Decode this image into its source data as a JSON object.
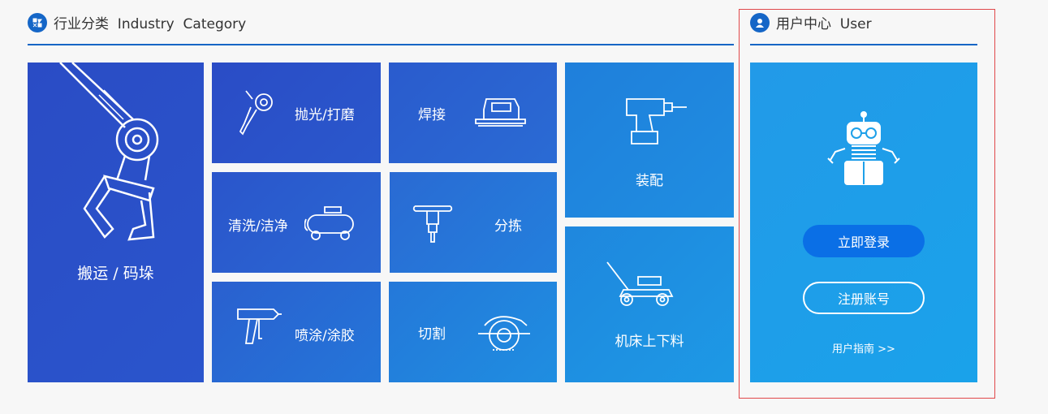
{
  "industry": {
    "title": "行业分类  Industry  Category",
    "icon": "grid-icon",
    "tiles": [
      {
        "label": "搬运 / 码垛",
        "icon": "robotic-arm-icon"
      },
      {
        "label": "抛光/打磨",
        "icon": "angle-grinder-icon"
      },
      {
        "label": "焊接",
        "icon": "planer-icon"
      },
      {
        "label": "装配",
        "icon": "power-drill-icon"
      },
      {
        "label": "清洗/洁净",
        "icon": "air-compressor-icon"
      },
      {
        "label": "分拣",
        "icon": "jackhammer-icon"
      },
      {
        "label": "喷涂/涂胶",
        "icon": "glue-gun-icon"
      },
      {
        "label": "切割",
        "icon": "circular-saw-icon"
      },
      {
        "label": "机床上下料",
        "icon": "lawn-mower-icon"
      }
    ]
  },
  "user_center": {
    "title": "用户中心  User",
    "icon": "user-icon",
    "mascot": "robot-icon",
    "login_label": "立即登录",
    "register_label": "注册账号",
    "guide_label": "用户指南 >>"
  },
  "colors": {
    "accent": "#1666c5",
    "tile_dark": "#2a4fc6",
    "tile_light": "#1d8fe0",
    "user_panel": "#1ea0e9",
    "login_button": "#0a6fe6",
    "highlight_border": "#e0484a"
  }
}
